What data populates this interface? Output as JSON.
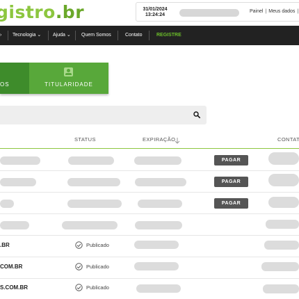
{
  "header": {
    "logo_text": "gistro",
    "logo_tld": ".br",
    "date": "31/01/2024",
    "time": "13:24:24",
    "links": [
      "Painel",
      "Meus dados"
    ]
  },
  "nav": {
    "items": [
      "Tecnologia",
      "Ajuda",
      "Quem Somos",
      "Contato"
    ],
    "register": "REGISTRE"
  },
  "tabs": {
    "left_label": "OS",
    "right_label": "TITULARIDADE"
  },
  "search": {
    "placeholder": ""
  },
  "table": {
    "columns": {
      "status": "STATUS",
      "expiration": "EXPIRAÇÃO",
      "contact": "CONTAT"
    },
    "pay_label": "PAGAR",
    "rows": [
      {
        "domain": "",
        "status": "",
        "pay": true
      },
      {
        "domain": "",
        "status": "",
        "pay": true
      },
      {
        "domain": "",
        "status": "",
        "pay": true
      },
      {
        "domain": "",
        "status": "",
        "pay": false
      },
      {
        "domain": ".BR",
        "status": "Publicado",
        "pay": false
      },
      {
        "domain": "COM.BR",
        "status": "Publicado",
        "pay": false
      },
      {
        "domain": "S.COM.BR",
        "status": "Publicado",
        "pay": false
      }
    ]
  },
  "colors": {
    "brand_green": "#8cc63f",
    "tab_green": "#58a83a",
    "nav_bg": "#222222",
    "pay_button": "#555555"
  }
}
